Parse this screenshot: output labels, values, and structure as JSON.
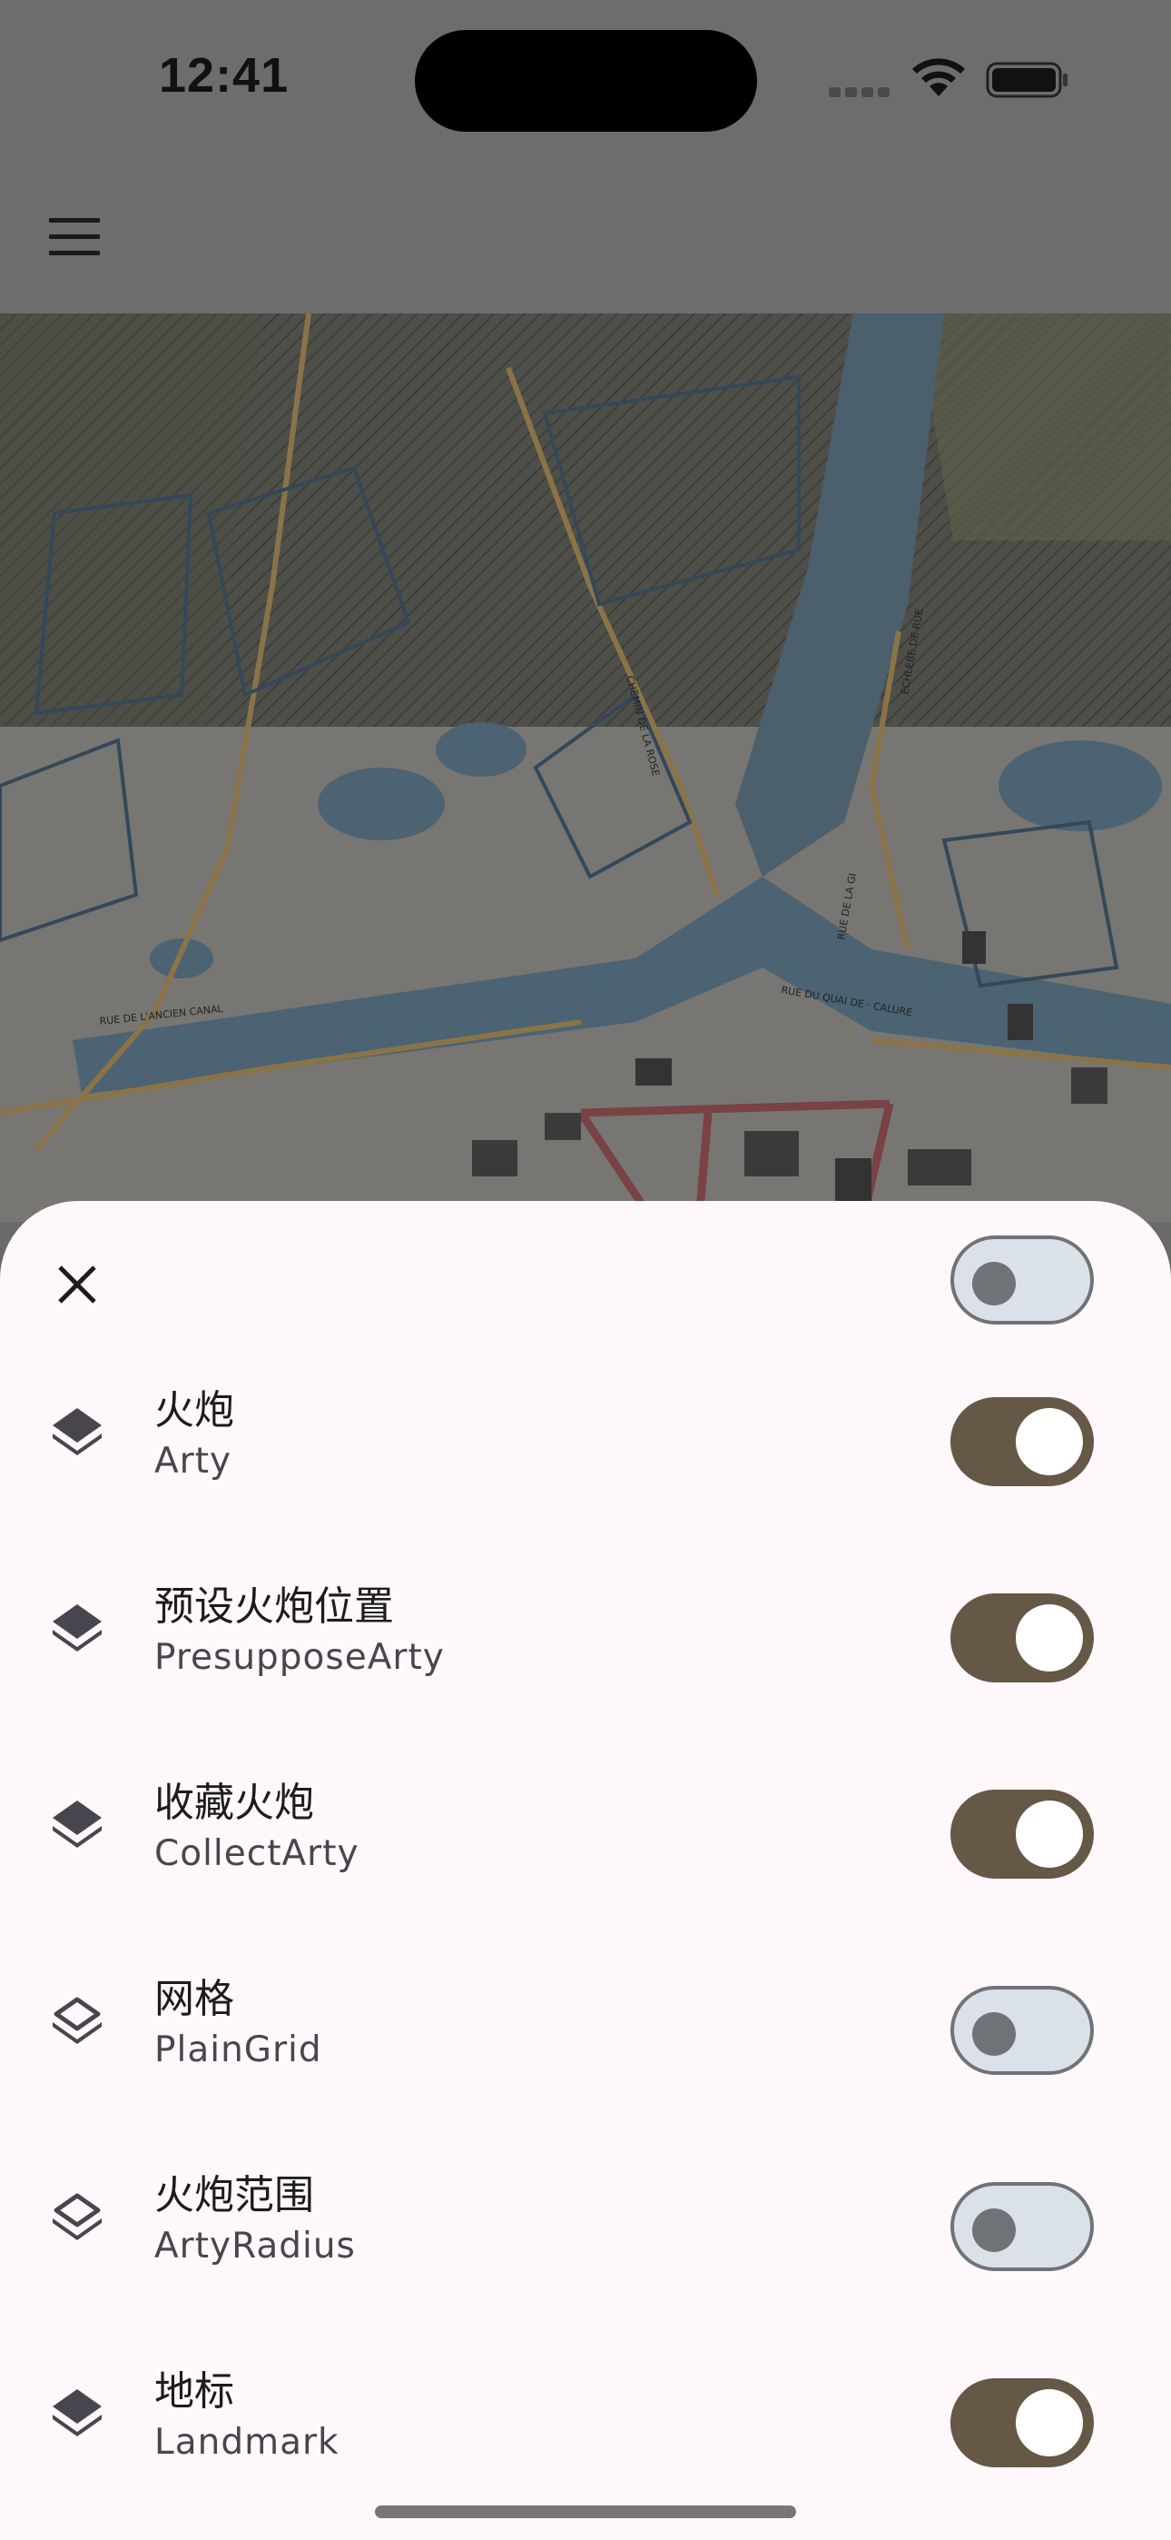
{
  "status_bar": {
    "time": "12:41"
  },
  "app_bar": {
    "menu_icon": "hamburger-menu-icon"
  },
  "map": {
    "labels": [
      "RUE DE L'ANCIEN CANAL",
      "RUE DU QUAI DE · CALURE",
      "CHEMIN DE LA ROSE",
      "ECHLEBE DE RUE",
      "RUE DE LA GI"
    ]
  },
  "sheet": {
    "close_icon": "close-icon",
    "master_toggle": {
      "on": false
    },
    "layers": [
      {
        "title": "火炮",
        "subtitle": "Arty",
        "icon": "layers-filled-icon",
        "on": true
      },
      {
        "title": "预设火炮位置",
        "subtitle": "PresupposeArty",
        "icon": "layers-filled-icon",
        "on": true
      },
      {
        "title": "收藏火炮",
        "subtitle": "CollectArty",
        "icon": "layers-filled-icon",
        "on": true
      },
      {
        "title": "网格",
        "subtitle": "PlainGrid",
        "icon": "layers-outline-icon",
        "on": false
      },
      {
        "title": "火炮范围",
        "subtitle": "ArtyRadius",
        "icon": "layers-outline-icon",
        "on": false
      },
      {
        "title": "地标",
        "subtitle": "Landmark",
        "icon": "layers-filled-icon",
        "on": true
      }
    ]
  },
  "colors": {
    "toggle_on": "#655847",
    "toggle_off_track": "#dae1e9",
    "toggle_off_border": "#6f7378",
    "sheet_bg": "#fff8fb",
    "scrim": "#6d6d6d"
  }
}
